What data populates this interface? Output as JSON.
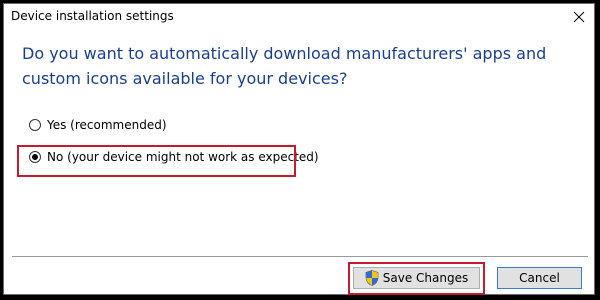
{
  "window": {
    "title": "Device installation settings"
  },
  "dialog": {
    "question": "Do you want to automatically download manufacturers' apps and custom icons available for your devices?",
    "options": [
      {
        "label": "Yes (recommended)",
        "selected": false
      },
      {
        "label": "No (your device might not work as expected)",
        "selected": true
      }
    ]
  },
  "buttons": {
    "save_label": "Save Changes",
    "cancel_label": "Cancel",
    "save_icon": "uac-shield-icon"
  },
  "colors": {
    "question_text": "#1a3f8f",
    "highlight": "#c41c2e",
    "button_bg": "#e1e1e1",
    "cancel_focus_border": "#3a7bd5"
  }
}
